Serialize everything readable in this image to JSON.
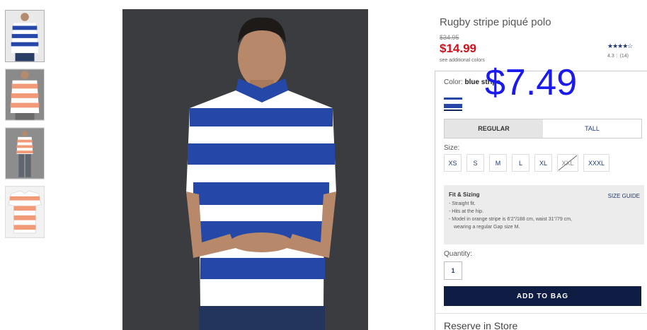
{
  "thumbnails": [
    {
      "name": "thumb-blue-stripe-front",
      "stripe": "#2548a8"
    },
    {
      "name": "thumb-orange-stripe-model",
      "stripe": "#f29a78"
    },
    {
      "name": "thumb-orange-stripe-full",
      "stripe": "#f29a78"
    },
    {
      "name": "thumb-orange-stripe-flat",
      "stripe": "#f29a78"
    }
  ],
  "product": {
    "title": "Rugby stripe piqué polo",
    "original_price": "$34.95",
    "sale_price": "$14.99",
    "see_colors": "see additional colors",
    "stars": "★★★★☆",
    "rating": "4.3",
    "review_count": "(14)",
    "overlay_price": "$7.49"
  },
  "color": {
    "label": "Color:",
    "value": "blue stripe"
  },
  "fit": {
    "tabs": [
      "REGULAR",
      "TALL"
    ],
    "selected": "REGULAR"
  },
  "size": {
    "label": "Size:",
    "options": [
      "XS",
      "S",
      "M",
      "L",
      "XL",
      "XXL",
      "XXXL"
    ],
    "unavailable": [
      "XXL"
    ]
  },
  "fit_sizing": {
    "heading": "Fit & Sizing",
    "guide_link": "SIZE GUIDE",
    "notes": [
      "- Straight fit.",
      "- Hits at the hip.",
      "- Model in orange stripe is 6'2\"/188 cm, waist 31\"/79 cm,",
      "  wearing a regular Gap size M."
    ]
  },
  "quantity": {
    "label": "Quantity:",
    "value": "1"
  },
  "cta": {
    "add_to_bag": "ADD TO BAG"
  },
  "reserve": {
    "label": "Reserve in Store"
  },
  "colors": {
    "accent": "#1f3a70",
    "sale_red": "#d0101a",
    "button_bg": "#0f1d45",
    "stripe_blue": "#2548a8",
    "overlay_blue": "#1a1aee"
  }
}
